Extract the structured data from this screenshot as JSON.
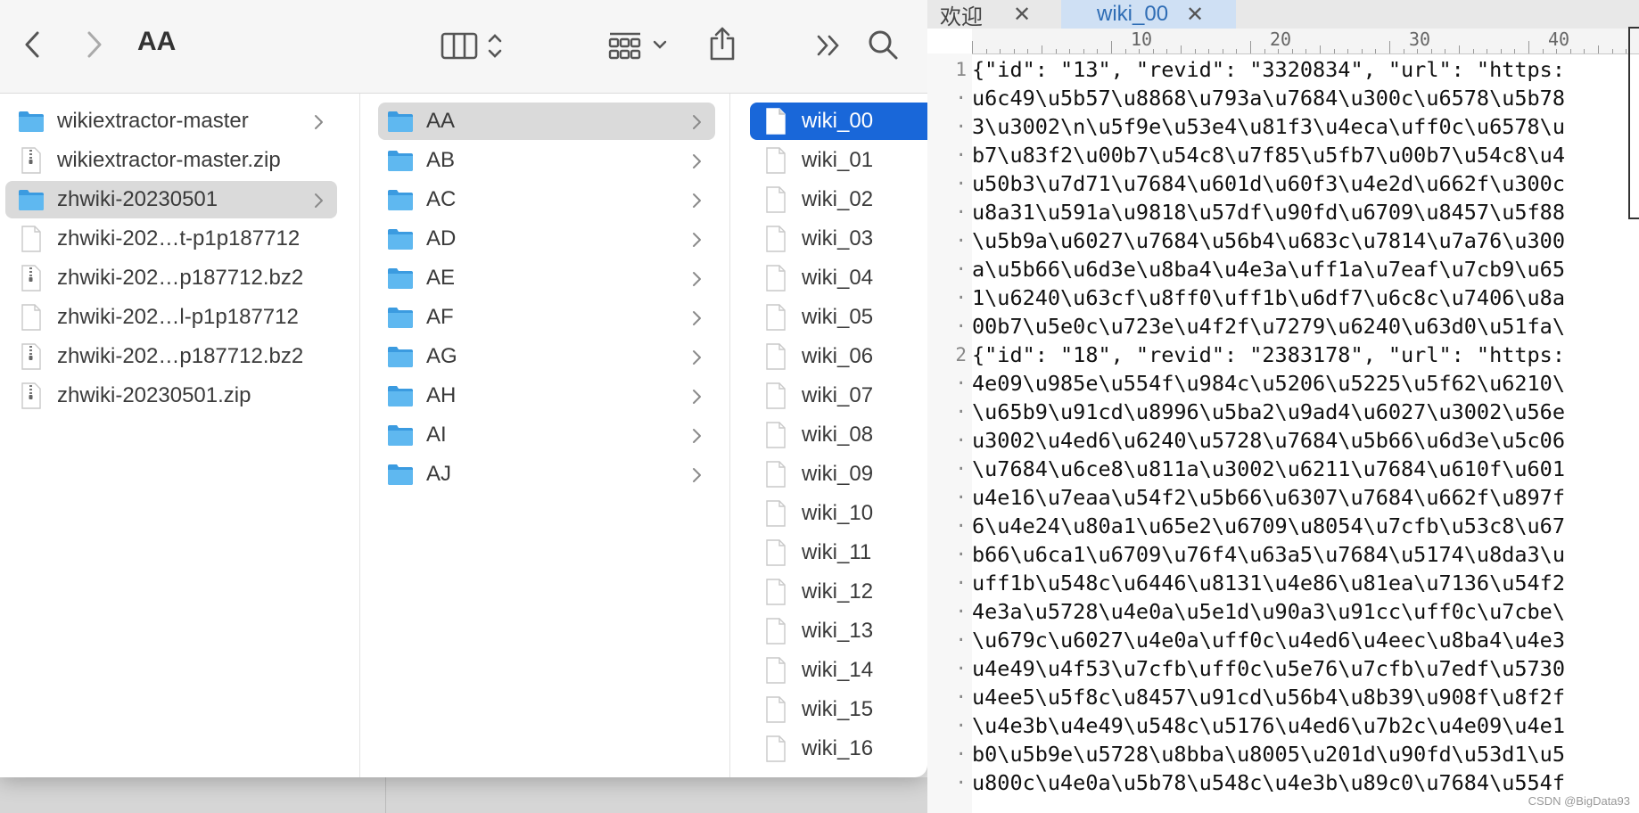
{
  "finder": {
    "title": "AA",
    "toolbar_icons": [
      "back-icon",
      "forward-icon",
      "column-view-icon",
      "group-icon",
      "share-icon",
      "more-icon",
      "search-icon"
    ],
    "column1": [
      {
        "name": "wikiextractor-master",
        "kind": "folder",
        "has_children": true,
        "selected": false
      },
      {
        "name": "wikiextractor-master.zip",
        "kind": "zip",
        "has_children": false,
        "selected": false
      },
      {
        "name": "zhwiki-20230501",
        "kind": "folder",
        "has_children": true,
        "selected": true
      },
      {
        "name": "zhwiki-202…t-p1p187712",
        "kind": "file",
        "has_children": false,
        "selected": false
      },
      {
        "name": "zhwiki-202…p187712.bz2",
        "kind": "zip",
        "has_children": false,
        "selected": false
      },
      {
        "name": "zhwiki-202…l-p1p187712",
        "kind": "file",
        "has_children": false,
        "selected": false
      },
      {
        "name": "zhwiki-202…p187712.bz2",
        "kind": "zip",
        "has_children": false,
        "selected": false
      },
      {
        "name": "zhwiki-20230501.zip",
        "kind": "zip",
        "has_children": false,
        "selected": false
      }
    ],
    "column2": [
      {
        "name": "AA",
        "selected": true
      },
      {
        "name": "AB",
        "selected": false
      },
      {
        "name": "AC",
        "selected": false
      },
      {
        "name": "AD",
        "selected": false
      },
      {
        "name": "AE",
        "selected": false
      },
      {
        "name": "AF",
        "selected": false
      },
      {
        "name": "AG",
        "selected": false
      },
      {
        "name": "AH",
        "selected": false
      },
      {
        "name": "AI",
        "selected": false
      },
      {
        "name": "AJ",
        "selected": false
      }
    ],
    "column3": [
      {
        "name": "wiki_00",
        "selected": true
      },
      {
        "name": "wiki_01",
        "selected": false
      },
      {
        "name": "wiki_02",
        "selected": false
      },
      {
        "name": "wiki_03",
        "selected": false
      },
      {
        "name": "wiki_04",
        "selected": false
      },
      {
        "name": "wiki_05",
        "selected": false
      },
      {
        "name": "wiki_06",
        "selected": false
      },
      {
        "name": "wiki_07",
        "selected": false
      },
      {
        "name": "wiki_08",
        "selected": false
      },
      {
        "name": "wiki_09",
        "selected": false
      },
      {
        "name": "wiki_10",
        "selected": false
      },
      {
        "name": "wiki_11",
        "selected": false
      },
      {
        "name": "wiki_12",
        "selected": false
      },
      {
        "name": "wiki_13",
        "selected": false
      },
      {
        "name": "wiki_14",
        "selected": false
      },
      {
        "name": "wiki_15",
        "selected": false
      },
      {
        "name": "wiki_16",
        "selected": false
      }
    ]
  },
  "editor": {
    "tabs": [
      {
        "label": "欢迎",
        "active": false
      },
      {
        "label": "wiki_00",
        "active": true
      }
    ],
    "ruler_marks": [
      "10",
      "20",
      "30",
      "40"
    ],
    "lines": [
      {
        "num": "1",
        "text": "{\"id\": \"13\", \"revid\": \"3320834\", \"url\": \"https:"
      },
      {
        "num": "",
        "text": "u6c49\\u5b57\\u8868\\u793a\\u7684\\u300c\\u6578\\u5b78"
      },
      {
        "num": "",
        "text": "3\\u3002\\n\\u5f9e\\u53e4\\u81f3\\u4eca\\uff0c\\u6578\\u"
      },
      {
        "num": "",
        "text": "b7\\u83f2\\u00b7\\u54c8\\u7f85\\u5fb7\\u00b7\\u54c8\\u4"
      },
      {
        "num": "",
        "text": "u50b3\\u7d71\\u7684\\u601d\\u60f3\\u4e2d\\u662f\\u300c"
      },
      {
        "num": "",
        "text": "u8a31\\u591a\\u9818\\u57df\\u90fd\\u6709\\u8457\\u5f88"
      },
      {
        "num": "",
        "text": "\\u5b9a\\u6027\\u7684\\u56b4\\u683c\\u7814\\u7a76\\u300"
      },
      {
        "num": "",
        "text": "a\\u5b66\\u6d3e\\u8ba4\\u4e3a\\uff1a\\u7eaf\\u7cb9\\u65"
      },
      {
        "num": "",
        "text": "1\\u6240\\u63cf\\u8ff0\\uff1b\\u6df7\\u6c8c\\u7406\\u8a"
      },
      {
        "num": "",
        "text": "00b7\\u5e0c\\u723e\\u4f2f\\u7279\\u6240\\u63d0\\u51fa\\"
      },
      {
        "num": "2",
        "text": "{\"id\": \"18\", \"revid\": \"2383178\", \"url\": \"https:"
      },
      {
        "num": "",
        "text": "4e09\\u985e\\u554f\\u984c\\u5206\\u5225\\u5f62\\u6210\\"
      },
      {
        "num": "",
        "text": "\\u65b9\\u91cd\\u8996\\u5ba2\\u9ad4\\u6027\\u3002\\u56e"
      },
      {
        "num": "",
        "text": "u3002\\u4ed6\\u6240\\u5728\\u7684\\u5b66\\u6d3e\\u5c06"
      },
      {
        "num": "",
        "text": "\\u7684\\u6ce8\\u811a\\u3002\\u6211\\u7684\\u610f\\u601"
      },
      {
        "num": "",
        "text": "u4e16\\u7eaa\\u54f2\\u5b66\\u6307\\u7684\\u662f\\u897f"
      },
      {
        "num": "",
        "text": "6\\u4e24\\u80a1\\u65e2\\u6709\\u8054\\u7cfb\\u53c8\\u67"
      },
      {
        "num": "",
        "text": "b66\\u6ca1\\u6709\\u76f4\\u63a5\\u7684\\u5174\\u8da3\\u"
      },
      {
        "num": "",
        "text": "uff1b\\u548c\\u6446\\u8131\\u4e86\\u81ea\\u7136\\u54f2"
      },
      {
        "num": "",
        "text": "4e3a\\u5728\\u4e0a\\u5e1d\\u90a3\\u91cc\\uff0c\\u7cbe\\"
      },
      {
        "num": "",
        "text": "\\u679c\\u6027\\u4e0a\\uff0c\\u4ed6\\u4eec\\u8ba4\\u4e3"
      },
      {
        "num": "",
        "text": "u4e49\\u4f53\\u7cfb\\uff0c\\u5e76\\u7cfb\\u7edf\\u5730"
      },
      {
        "num": "",
        "text": "u4ee5\\u5f8c\\u8457\\u91cd\\u56b4\\u8b39\\u908f\\u8f2f"
      },
      {
        "num": "",
        "text": "\\u4e3b\\u4e49\\u548c\\u5176\\u4ed6\\u7b2c\\u4e09\\u4e1"
      },
      {
        "num": "",
        "text": "b0\\u5b9e\\u5728\\u8bba\\u8005\\u201d\\u90fd\\u53d1\\u5"
      },
      {
        "num": "",
        "text": "u800c\\u4e0a\\u5b78\\u548c\\u4e3b\\u89c0\\u7684\\u554f"
      }
    ]
  },
  "watermark": "CSDN @BigData93",
  "colors": {
    "selection_blue": "#1967d9",
    "selection_gray": "#dadada",
    "folder_blue": "#4aaee8"
  }
}
